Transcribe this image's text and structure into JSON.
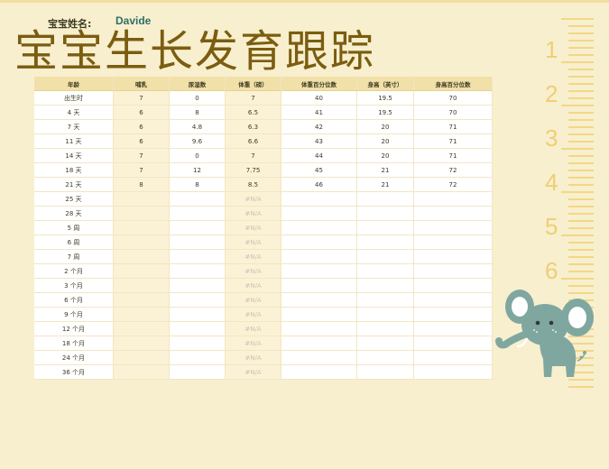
{
  "header": {
    "baby_name_label": "宝宝姓名:",
    "baby_name": "Davide",
    "title": "宝宝生长发育跟踪"
  },
  "table": {
    "columns": [
      "年龄",
      "哺乳",
      "尿湿数",
      "体重（磅）",
      "体重百分位数",
      "身高（英寸）",
      "身高百分位数"
    ],
    "rows": [
      [
        "出生时",
        "7",
        "0",
        "7",
        "40",
        "19.5",
        "70"
      ],
      [
        "4 天",
        "6",
        "8",
        "6.5",
        "41",
        "19.5",
        "70"
      ],
      [
        "7 天",
        "6",
        "4.8",
        "6.3",
        "42",
        "20",
        "71"
      ],
      [
        "11 天",
        "6",
        "9.6",
        "6.6",
        "43",
        "20",
        "71"
      ],
      [
        "14 天",
        "7",
        "0",
        "7",
        "44",
        "20",
        "71"
      ],
      [
        "18 天",
        "7",
        "12",
        "7.75",
        "45",
        "21",
        "72"
      ],
      [
        "21 天",
        "8",
        "8",
        "8.5",
        "46",
        "21",
        "72"
      ],
      [
        "25 天",
        "",
        "",
        "#N/A",
        "",
        "",
        ""
      ],
      [
        "28 天",
        "",
        "",
        "#N/A",
        "",
        "",
        ""
      ],
      [
        "5 周",
        "",
        "",
        "#N/A",
        "",
        "",
        ""
      ],
      [
        "6 周",
        "",
        "",
        "#N/A",
        "",
        "",
        ""
      ],
      [
        "7 周",
        "",
        "",
        "#N/A",
        "",
        "",
        ""
      ],
      [
        "2 个月",
        "",
        "",
        "#N/A",
        "",
        "",
        ""
      ],
      [
        "3 个月",
        "",
        "",
        "#N/A",
        "",
        "",
        ""
      ],
      [
        "6 个月",
        "",
        "",
        "#N/A",
        "",
        "",
        ""
      ],
      [
        "9 个月",
        "",
        "",
        "#N/A",
        "",
        "",
        ""
      ],
      [
        "12 个月",
        "",
        "",
        "#N/A",
        "",
        "",
        ""
      ],
      [
        "18 个月",
        "",
        "",
        "#N/A",
        "",
        "",
        ""
      ],
      [
        "24 个月",
        "",
        "",
        "#N/A",
        "",
        "",
        ""
      ],
      [
        "36 个月",
        "",
        "",
        "#N/A",
        "",
        "",
        ""
      ]
    ]
  },
  "ruler": {
    "numbers": [
      "1",
      "2",
      "3",
      "4",
      "5",
      "6"
    ]
  },
  "colors": {
    "background": "#f8efcf",
    "title": "#7a5d10",
    "header_row": "#f1e0a8",
    "shaded_column": "#fbf2d6",
    "name": "#2f6e66",
    "ruler": "#f3d784",
    "elephant": "#7fa7a0"
  },
  "icons": {
    "decoration": "elephant-illustration",
    "ruler": "growth-ruler"
  }
}
